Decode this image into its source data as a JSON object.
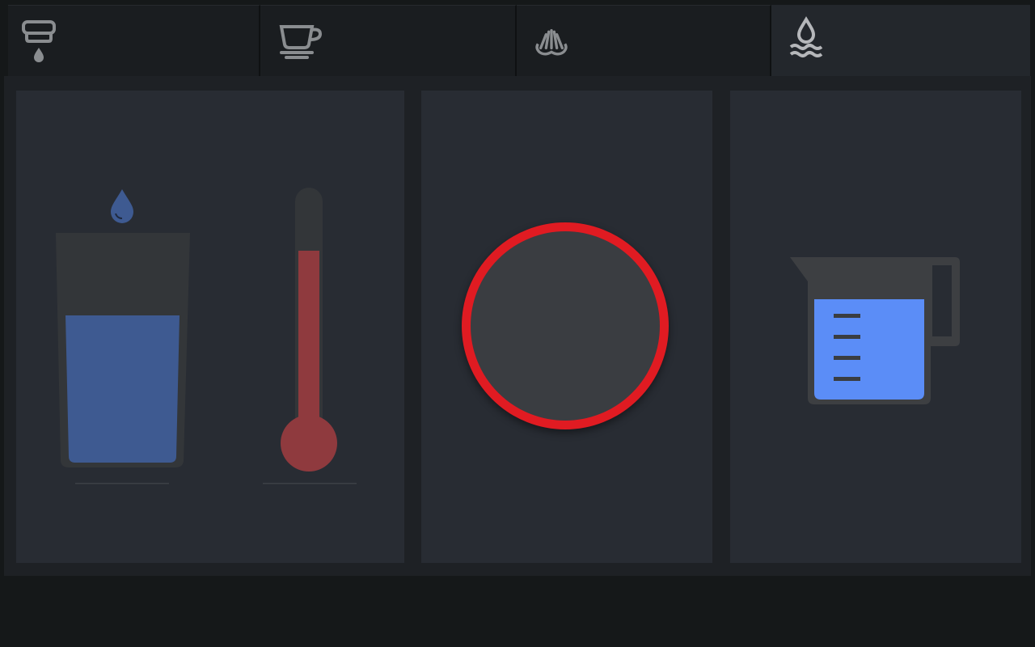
{
  "tabs": [
    {
      "id": "dispense",
      "icon": "spout-drip-icon",
      "active": false
    },
    {
      "id": "coffee",
      "icon": "coffee-cup-icon",
      "active": false
    },
    {
      "id": "steam",
      "icon": "steam-wand-icon",
      "active": false
    },
    {
      "id": "water",
      "icon": "water-drop-waves-icon",
      "active": true
    }
  ],
  "panels": {
    "water_glass": {
      "icon": "water-glass-icon",
      "fill_level": 0.65
    },
    "temperature": {
      "icon": "thermometer-icon",
      "fill_level": 0.77
    },
    "start": {
      "icon": "start-ring-icon"
    },
    "jug": {
      "icon": "measuring-jug-icon",
      "fill_level": 0.85
    }
  },
  "colors": {
    "accent_red": "#e01b22",
    "water_blue": "#3e5a91",
    "jug_blue": "#5b8df7",
    "thermo_red": "#8f3a3e",
    "panel_bg": "#282c33"
  }
}
